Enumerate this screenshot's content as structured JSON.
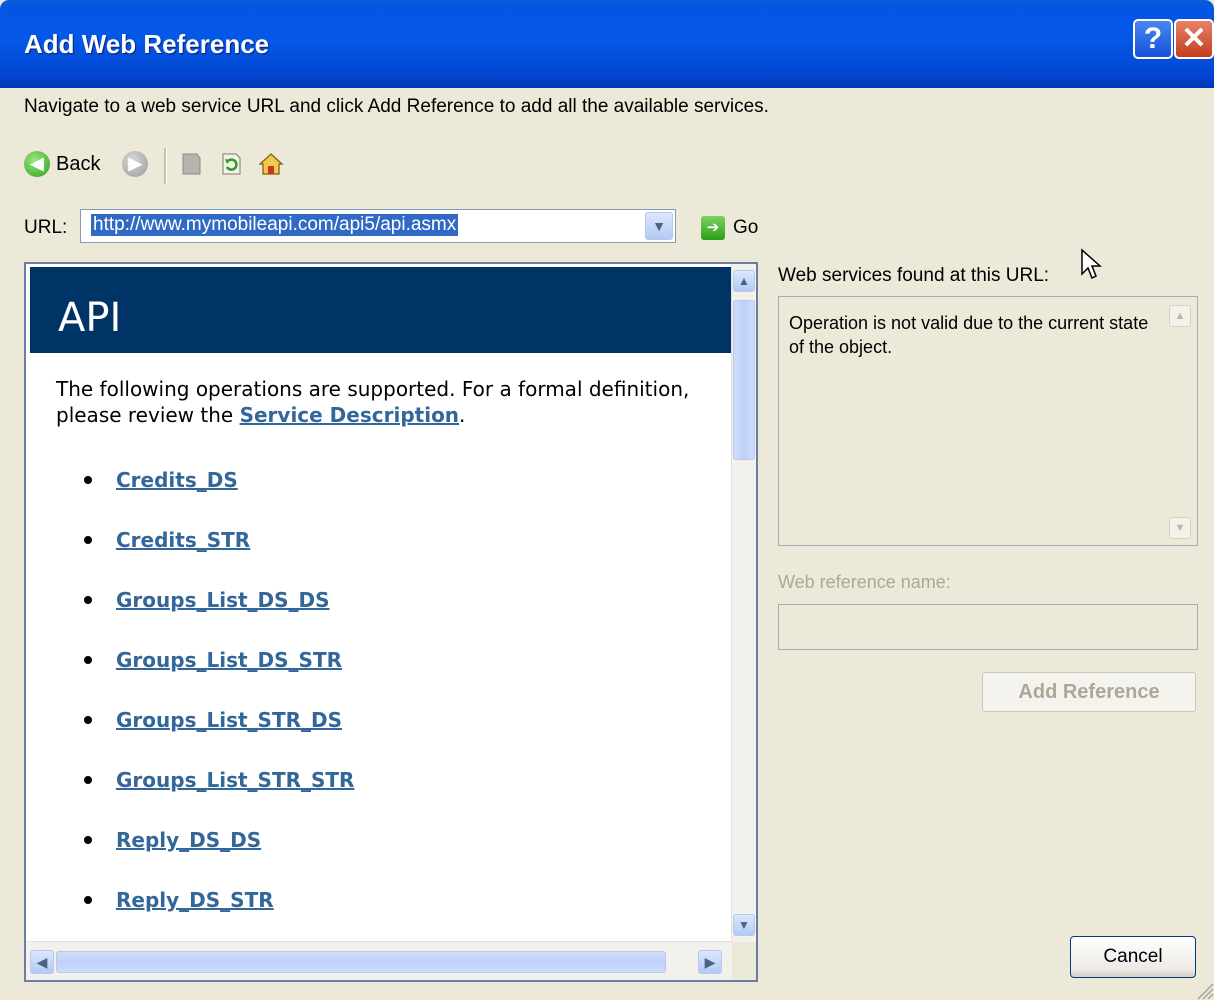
{
  "window": {
    "title": "Add Web Reference",
    "help_glyph": "?",
    "close_glyph": "✕"
  },
  "instruction": "Navigate to a web service URL and click Add Reference to add all the available services.",
  "toolbar": {
    "back_label": "Back",
    "icons": [
      "back-arrow-icon",
      "forward-arrow-icon",
      "stop-icon",
      "refresh-icon",
      "home-icon"
    ]
  },
  "url": {
    "label": "URL:",
    "value": "http://www.mymobileapi.com/api5/api.asmx",
    "go_label": "Go"
  },
  "browser": {
    "banner_title": "API",
    "intro_prefix": "The following operations are supported. For a formal definition, please review the ",
    "service_description_link": "Service Description",
    "intro_suffix": ".",
    "operations": [
      "Credits_DS",
      "Credits_STR",
      "Groups_List_DS_DS",
      "Groups_List_DS_STR",
      "Groups_List_STR_DS",
      "Groups_List_STR_STR",
      "Reply_DS_DS",
      "Reply_DS_STR"
    ]
  },
  "right_panel": {
    "services_label": "Web services found at this URL:",
    "services_message": "Operation is not valid due to the current state of the object.",
    "ref_name_label": "Web reference name:",
    "ref_name_value": "",
    "add_reference_label": "Add Reference",
    "cancel_label": "Cancel"
  },
  "colors": {
    "titlebar": "#0458e8",
    "dialog_bg": "#ece9d8",
    "api_banner": "#003366",
    "link": "#336699",
    "selection": "#316ac5",
    "disabled_text": "#aca899"
  }
}
